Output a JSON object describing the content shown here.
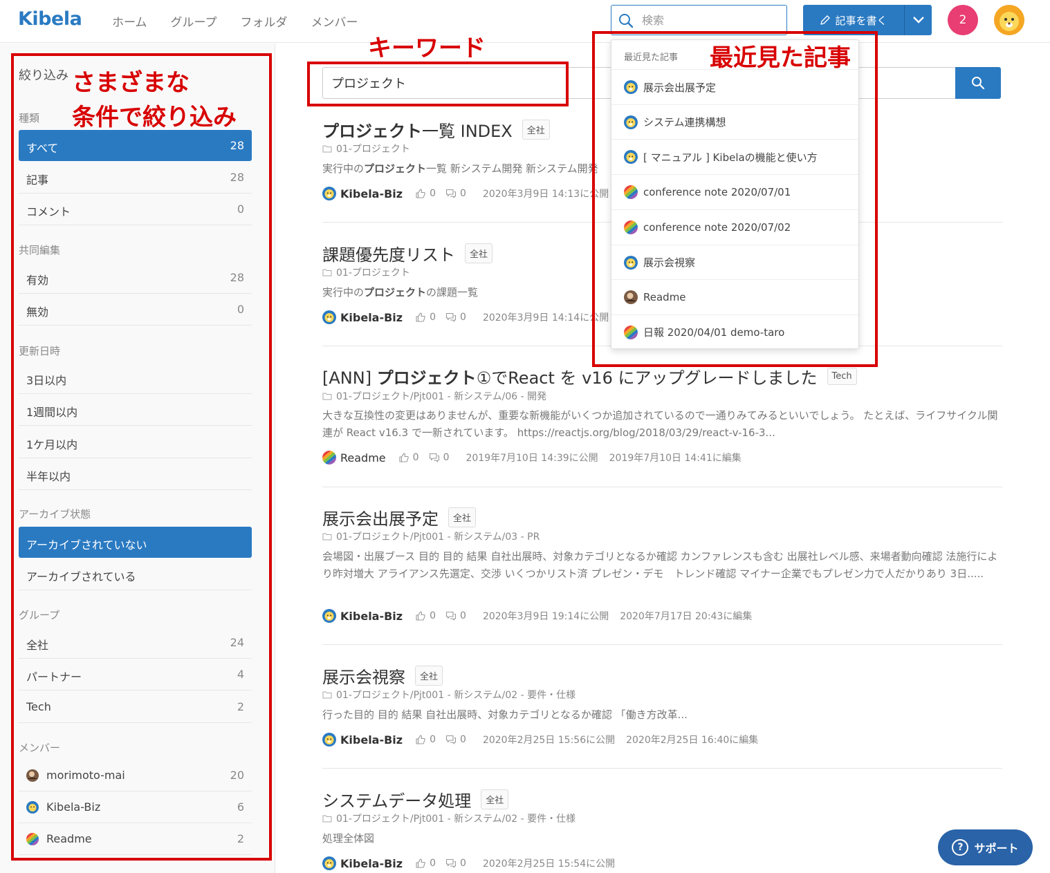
{
  "header": {
    "logo": "Kibela",
    "nav": [
      "ホーム",
      "グループ",
      "フォルダ",
      "メンバー"
    ],
    "search_placeholder": "検索",
    "write_label": "記事を書く",
    "notification_count": "2"
  },
  "sidebar": {
    "title": "絞り込み",
    "sections": [
      {
        "label": "種類",
        "items": [
          {
            "label": "すべて",
            "count": "28",
            "active": true
          },
          {
            "label": "記事",
            "count": "28"
          },
          {
            "label": "コメント",
            "count": "0"
          }
        ]
      },
      {
        "label": "共同編集",
        "items": [
          {
            "label": "有効",
            "count": "28"
          },
          {
            "label": "無効",
            "count": "0"
          }
        ]
      },
      {
        "label": "更新日時",
        "items": [
          {
            "label": "3日以内",
            "count": ""
          },
          {
            "label": "1週間以内",
            "count": ""
          },
          {
            "label": "1ケ月以内",
            "count": ""
          },
          {
            "label": "半年以内",
            "count": ""
          }
        ]
      },
      {
        "label": "アーカイブ状態",
        "items": [
          {
            "label": "アーカイブされていない",
            "count": "",
            "active": true
          },
          {
            "label": "アーカイブされている",
            "count": ""
          }
        ]
      },
      {
        "label": "グループ",
        "items": [
          {
            "label": "全社",
            "count": "24"
          },
          {
            "label": "パートナー",
            "count": "4"
          },
          {
            "label": "Tech",
            "count": "2"
          }
        ]
      },
      {
        "label": "メンバー",
        "items": [
          {
            "label": "morimoto-mai",
            "count": "20",
            "avatar": "photo"
          },
          {
            "label": "Kibela-Biz",
            "count": "6",
            "avatar": "lion"
          },
          {
            "label": "Readme",
            "count": "2",
            "avatar": "stripes"
          }
        ]
      }
    ]
  },
  "search": {
    "keyword": "プロジェクト"
  },
  "results": [
    {
      "title_bold": "プロジェクト",
      "title_rest": "一覧 INDEX",
      "badge": "全社",
      "folder": "01-プロジェクト",
      "excerpt_pre": "実行中の",
      "excerpt_bold": "プロジェクト",
      "excerpt_post": "一覧 新システム開発 新システム開発",
      "author": "Kibela-Biz",
      "avatar": "lion",
      "likes": "0",
      "comments": "0",
      "published": "2020年3月9日 14:13に公開",
      "edited": ""
    },
    {
      "title_pre": "課題優先度リスト",
      "badge": "全社",
      "folder": "01-プロジェクト",
      "excerpt_pre": "実行中の",
      "excerpt_bold": "プロジェクト",
      "excerpt_post": "の課題一覧",
      "author": "Kibela-Biz",
      "avatar": "lion",
      "likes": "0",
      "comments": "0",
      "published": "2020年3月9日 14:14に公開",
      "edited": ""
    },
    {
      "title_pre": "[ANN] ",
      "title_bold": "プロジェクト",
      "title_rest": "①でReact を v16 にアップグレードしました",
      "badge": "Tech",
      "folder": "01-プロジェクト/Pjt001 - 新システム/06 - 開発",
      "excerpt_post": "大きな互換性の変更はありませんが、重要な新機能がいくつか追加されているので一通りみてみるといいでしょう。 たとえば、ライフサイクル関連が React v16.3 で一新されています。 https://reactjs.org/blog/2018/03/29/react-v-16-3...",
      "author": "Readme",
      "avatar": "stripes",
      "likes": "0",
      "comments": "0",
      "published": "2019年7月10日 14:39に公開",
      "edited": "2019年7月10日 14:41に編集"
    },
    {
      "title_pre": "展示会出展予定",
      "badge": "全社",
      "folder": "01-プロジェクト/Pjt001 - 新システム/03 - PR",
      "excerpt_post": "会場図・出展ブース 目的 目的 結果 自社出展時、対象カテゴリとなるか確認 カンファレンスも含む 出展社レベル感、来場者動向確認 法施行により昨対増大 アライアンス先選定、交渉 いくつかリスト済 プレゼン・デモ　トレンド確認 マイナー企業でもプレゼン力で人だかりあり 3日.....",
      "author": "Kibela-Biz",
      "avatar": "lion",
      "likes": "0",
      "comments": "0",
      "published": "2020年3月9日 19:14に公開",
      "edited": "2020年7月17日 20:43に編集"
    },
    {
      "title_pre": "展示会視察",
      "badge": "全社",
      "folder": "01-プロジェクト/Pjt001 - 新システム/02 - 要件・仕様",
      "excerpt_post": "行った目的 目的 結果 自社出展時、対象カテゴリとなるか確認 「働き方改革...",
      "author": "Kibela-Biz",
      "avatar": "lion",
      "likes": "0",
      "comments": "0",
      "published": "2020年2月25日 15:56に公開",
      "edited": "2020年2月25日 16:40に編集"
    },
    {
      "title_pre": "システムデータ処理",
      "badge": "全社",
      "folder": "01-プロジェクト/Pjt001 - 新システム/02 - 要件・仕様",
      "excerpt_post": "処理全体図",
      "author": "Kibela-Biz",
      "avatar": "lion",
      "likes": "0",
      "comments": "0",
      "published": "2020年2月25日 15:54に公開",
      "edited": ""
    }
  ],
  "recent": {
    "heading": "最近見た記事",
    "items": [
      {
        "label": "展示会出展予定",
        "avatar": "lion"
      },
      {
        "label": "システム連携構想",
        "avatar": "lion"
      },
      {
        "label": "[ マニュアル ] Kibelaの機能と使い方",
        "avatar": "lion"
      },
      {
        "label": "conference note 2020/07/01",
        "avatar": "stripes"
      },
      {
        "label": "conference note 2020/07/02",
        "avatar": "stripes"
      },
      {
        "label": "展示会視察",
        "avatar": "lion"
      },
      {
        "label": "Readme",
        "avatar": "photo"
      },
      {
        "label": "日報 2020/04/01 demo-taro",
        "avatar": "stripes"
      }
    ]
  },
  "annotations": {
    "filter_line1": "さまざまな",
    "filter_line2": "条件で絞り込み",
    "keyword": "キーワード",
    "recent": "最近見た記事"
  },
  "support_label": "サポート",
  "colors": {
    "accent": "#2a7ac2",
    "annotation": "#d80000",
    "notification": "#e83e73"
  }
}
